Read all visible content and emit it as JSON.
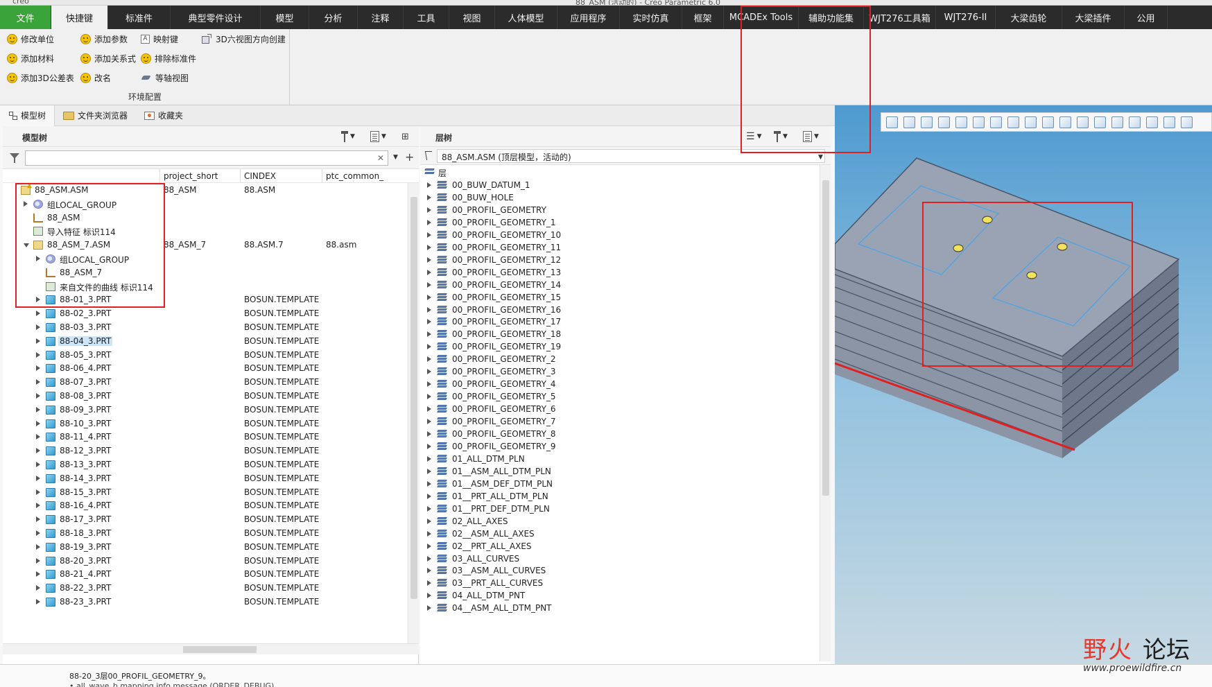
{
  "app": {
    "title_fragment": "88_ASM (活动的) - Creo Parametric 6.0",
    "logo_fragment": "creo"
  },
  "ribbon": {
    "tabs": [
      {
        "label": "文件",
        "kind": "file"
      },
      {
        "label": "快捷键",
        "kind": "active"
      },
      {
        "label": "标准件"
      },
      {
        "label": "典型零件设计"
      },
      {
        "label": "模型"
      },
      {
        "label": "分析"
      },
      {
        "label": "注释"
      },
      {
        "label": "工具"
      },
      {
        "label": "视图"
      },
      {
        "label": "人体模型"
      },
      {
        "label": "应用程序"
      },
      {
        "label": "实时仿真"
      },
      {
        "label": "框架"
      },
      {
        "label": "MCADEx Tools"
      },
      {
        "label": "辅助功能集"
      },
      {
        "label": "WJT276工具箱"
      },
      {
        "label": "WJT276-II"
      },
      {
        "label": "大梁齿轮"
      },
      {
        "label": "大梁插件"
      },
      {
        "label": "公用"
      }
    ],
    "buttons": {
      "modify_units": "修改单位",
      "add_parameter": "添加参数",
      "mapkey": "映射键",
      "six_views": "3D六视图方向创建",
      "add_material": "添加材料",
      "add_relation": "添加关系式",
      "exclude_std": "排除标准件",
      "add_3d_tolerance": "添加3D公差表",
      "rename": "改名",
      "iso_view": "等轴视图"
    },
    "group_label": "环境配置"
  },
  "panel_tabs": {
    "model_tree": "模型树",
    "folder_browser": "文件夹浏览器",
    "favorites": "收藏夹"
  },
  "model_tree": {
    "title": "模型树",
    "search_value": "",
    "columns": [
      "project_short",
      "CINDEX",
      "ptc_common_"
    ],
    "rows": [
      {
        "name": "88_ASM.ASM",
        "icon": "asm",
        "indent": 0,
        "expand": "none",
        "warn": true,
        "project_short": "88_ASM",
        "cindex": "88.ASM",
        "ptc": ""
      },
      {
        "name": "组LOCAL_GROUP",
        "icon": "group",
        "indent": 1,
        "expand": "right",
        "project_short": "",
        "cindex": "",
        "ptc": ""
      },
      {
        "name": "88_ASM",
        "icon": "csys",
        "indent": 1,
        "expand": "none",
        "project_short": "",
        "cindex": "",
        "ptc": ""
      },
      {
        "name": "导入特征 标识114",
        "icon": "feature",
        "indent": 1,
        "expand": "none",
        "project_short": "",
        "cindex": "",
        "ptc": ""
      },
      {
        "name": "88_ASM_7.ASM",
        "icon": "asm",
        "indent": 1,
        "expand": "down",
        "project_short": "88_ASM_7",
        "cindex": "88.ASM.7",
        "ptc": "88.asm"
      },
      {
        "name": "组LOCAL_GROUP",
        "icon": "group",
        "indent": 2,
        "expand": "right",
        "project_short": "",
        "cindex": "",
        "ptc": ""
      },
      {
        "name": "88_ASM_7",
        "icon": "csys",
        "indent": 2,
        "expand": "none",
        "project_short": "",
        "cindex": "",
        "ptc": ""
      },
      {
        "name": "来自文件的曲线 标识114",
        "icon": "feature",
        "indent": 2,
        "expand": "none",
        "project_short": "",
        "cindex": "",
        "ptc": ""
      },
      {
        "name": "88-01_3.PRT",
        "icon": "part",
        "indent": 2,
        "expand": "right",
        "project_short": "",
        "cindex": "BOSUN.TEMPLATE",
        "ptc": ""
      },
      {
        "name": "88-02_3.PRT",
        "icon": "part",
        "indent": 2,
        "expand": "right",
        "project_short": "",
        "cindex": "BOSUN.TEMPLATE",
        "ptc": ""
      },
      {
        "name": "88-03_3.PRT",
        "icon": "part",
        "indent": 2,
        "expand": "right",
        "project_short": "",
        "cindex": "BOSUN.TEMPLATE",
        "ptc": ""
      },
      {
        "name": "88-04_3.PRT",
        "icon": "part",
        "indent": 2,
        "expand": "right",
        "selected": true,
        "project_short": "",
        "cindex": "BOSUN.TEMPLATE",
        "ptc": ""
      },
      {
        "name": "88-05_3.PRT",
        "icon": "part",
        "indent": 2,
        "expand": "right",
        "project_short": "",
        "cindex": "BOSUN.TEMPLATE",
        "ptc": ""
      },
      {
        "name": "88-06_4.PRT",
        "icon": "part",
        "indent": 2,
        "expand": "right",
        "project_short": "",
        "cindex": "BOSUN.TEMPLATE",
        "ptc": ""
      },
      {
        "name": "88-07_3.PRT",
        "icon": "part",
        "indent": 2,
        "expand": "right",
        "project_short": "",
        "cindex": "BOSUN.TEMPLATE",
        "ptc": ""
      },
      {
        "name": "88-08_3.PRT",
        "icon": "part",
        "indent": 2,
        "expand": "right",
        "project_short": "",
        "cindex": "BOSUN.TEMPLATE",
        "ptc": ""
      },
      {
        "name": "88-09_3.PRT",
        "icon": "part",
        "indent": 2,
        "expand": "right",
        "project_short": "",
        "cindex": "BOSUN.TEMPLATE",
        "ptc": ""
      },
      {
        "name": "88-10_3.PRT",
        "icon": "part",
        "indent": 2,
        "expand": "right",
        "project_short": "",
        "cindex": "BOSUN.TEMPLATE",
        "ptc": ""
      },
      {
        "name": "88-11_4.PRT",
        "icon": "part",
        "indent": 2,
        "expand": "right",
        "project_short": "",
        "cindex": "BOSUN.TEMPLATE",
        "ptc": ""
      },
      {
        "name": "88-12_3.PRT",
        "icon": "part",
        "indent": 2,
        "expand": "right",
        "project_short": "",
        "cindex": "BOSUN.TEMPLATE",
        "ptc": ""
      },
      {
        "name": "88-13_3.PRT",
        "icon": "part",
        "indent": 2,
        "expand": "right",
        "project_short": "",
        "cindex": "BOSUN.TEMPLATE",
        "ptc": ""
      },
      {
        "name": "88-14_3.PRT",
        "icon": "part",
        "indent": 2,
        "expand": "right",
        "project_short": "",
        "cindex": "BOSUN.TEMPLATE",
        "ptc": ""
      },
      {
        "name": "88-15_3.PRT",
        "icon": "part",
        "indent": 2,
        "expand": "right",
        "project_short": "",
        "cindex": "BOSUN.TEMPLATE",
        "ptc": ""
      },
      {
        "name": "88-16_4.PRT",
        "icon": "part",
        "indent": 2,
        "expand": "right",
        "project_short": "",
        "cindex": "BOSUN.TEMPLATE",
        "ptc": ""
      },
      {
        "name": "88-17_3.PRT",
        "icon": "part",
        "indent": 2,
        "expand": "right",
        "project_short": "",
        "cindex": "BOSUN.TEMPLATE",
        "ptc": ""
      },
      {
        "name": "88-18_3.PRT",
        "icon": "part",
        "indent": 2,
        "expand": "right",
        "project_short": "",
        "cindex": "BOSUN.TEMPLATE",
        "ptc": ""
      },
      {
        "name": "88-19_3.PRT",
        "icon": "part",
        "indent": 2,
        "expand": "right",
        "project_short": "",
        "cindex": "BOSUN.TEMPLATE",
        "ptc": ""
      },
      {
        "name": "88-20_3.PRT",
        "icon": "part",
        "indent": 2,
        "expand": "right",
        "project_short": "",
        "cindex": "BOSUN.TEMPLATE",
        "ptc": ""
      },
      {
        "name": "88-21_4.PRT",
        "icon": "part",
        "indent": 2,
        "expand": "right",
        "project_short": "",
        "cindex": "BOSUN.TEMPLATE",
        "ptc": ""
      },
      {
        "name": "88-22_3.PRT",
        "icon": "part",
        "indent": 2,
        "expand": "right",
        "project_short": "",
        "cindex": "BOSUN.TEMPLATE",
        "ptc": ""
      },
      {
        "name": "88-23_3.PRT",
        "icon": "part",
        "indent": 2,
        "expand": "right",
        "project_short": "",
        "cindex": "BOSUN.TEMPLATE",
        "ptc": ""
      }
    ]
  },
  "layer_tree": {
    "title": "层树",
    "model_select": "88_ASM.ASM (顶层模型，活动的)",
    "header_label": "层",
    "layers": [
      "00_BUW_DATUM_1",
      "00_BUW_HOLE",
      "00_PROFIL_GEOMETRY",
      "00_PROFIL_GEOMETRY_1",
      "00_PROFIL_GEOMETRY_10",
      "00_PROFIL_GEOMETRY_11",
      "00_PROFIL_GEOMETRY_12",
      "00_PROFIL_GEOMETRY_13",
      "00_PROFIL_GEOMETRY_14",
      "00_PROFIL_GEOMETRY_15",
      "00_PROFIL_GEOMETRY_16",
      "00_PROFIL_GEOMETRY_17",
      "00_PROFIL_GEOMETRY_18",
      "00_PROFIL_GEOMETRY_19",
      "00_PROFIL_GEOMETRY_2",
      "00_PROFIL_GEOMETRY_3",
      "00_PROFIL_GEOMETRY_4",
      "00_PROFIL_GEOMETRY_5",
      "00_PROFIL_GEOMETRY_6",
      "00_PROFIL_GEOMETRY_7",
      "00_PROFIL_GEOMETRY_8",
      "00_PROFIL_GEOMETRY_9",
      "01_ALL_DTM_PLN",
      "01__ASM_ALL_DTM_PLN",
      "01__ASM_DEF_DTM_PLN",
      "01__PRT_ALL_DTM_PLN",
      "01__PRT_DEF_DTM_PLN",
      "02_ALL_AXES",
      "02__ASM_ALL_AXES",
      "02__PRT_ALL_AXES",
      "03_ALL_CURVES",
      "03__ASM_ALL_CURVES",
      "03__PRT_ALL_CURVES",
      "04_ALL_DTM_PNT",
      "04__ASM_ALL_DTM_PNT"
    ]
  },
  "viewport": {
    "toolbar_icons": [
      "refit-icon",
      "zoom-in-icon",
      "zoom-out-icon",
      "repaint-icon",
      "display-style-icon",
      "saved-orientations-icon",
      "view-manager-icon",
      "perspective-icon",
      "section-icon",
      "datum-display-icon",
      "plane-display-icon",
      "axis-display-icon",
      "point-display-icon",
      "csys-display-icon",
      "annotation-display-icon",
      "spin-center-icon",
      "appearance-icon",
      "render-icon"
    ],
    "colors": {
      "model_top": "#9aa3b4",
      "model_side": "#7d8799",
      "sketch_line": "#4aa3e6",
      "highlight": "#e02020"
    }
  },
  "messages": {
    "line1": "88-20_3层00_PROFIL_GEOMETRY_9。",
    "line2": "• all_wave_b mapping info message (ORDER_DEBUG)"
  },
  "watermark": {
    "text_a": "野火",
    "text_b": "论坛",
    "url": "www.proewildfire.cn"
  }
}
